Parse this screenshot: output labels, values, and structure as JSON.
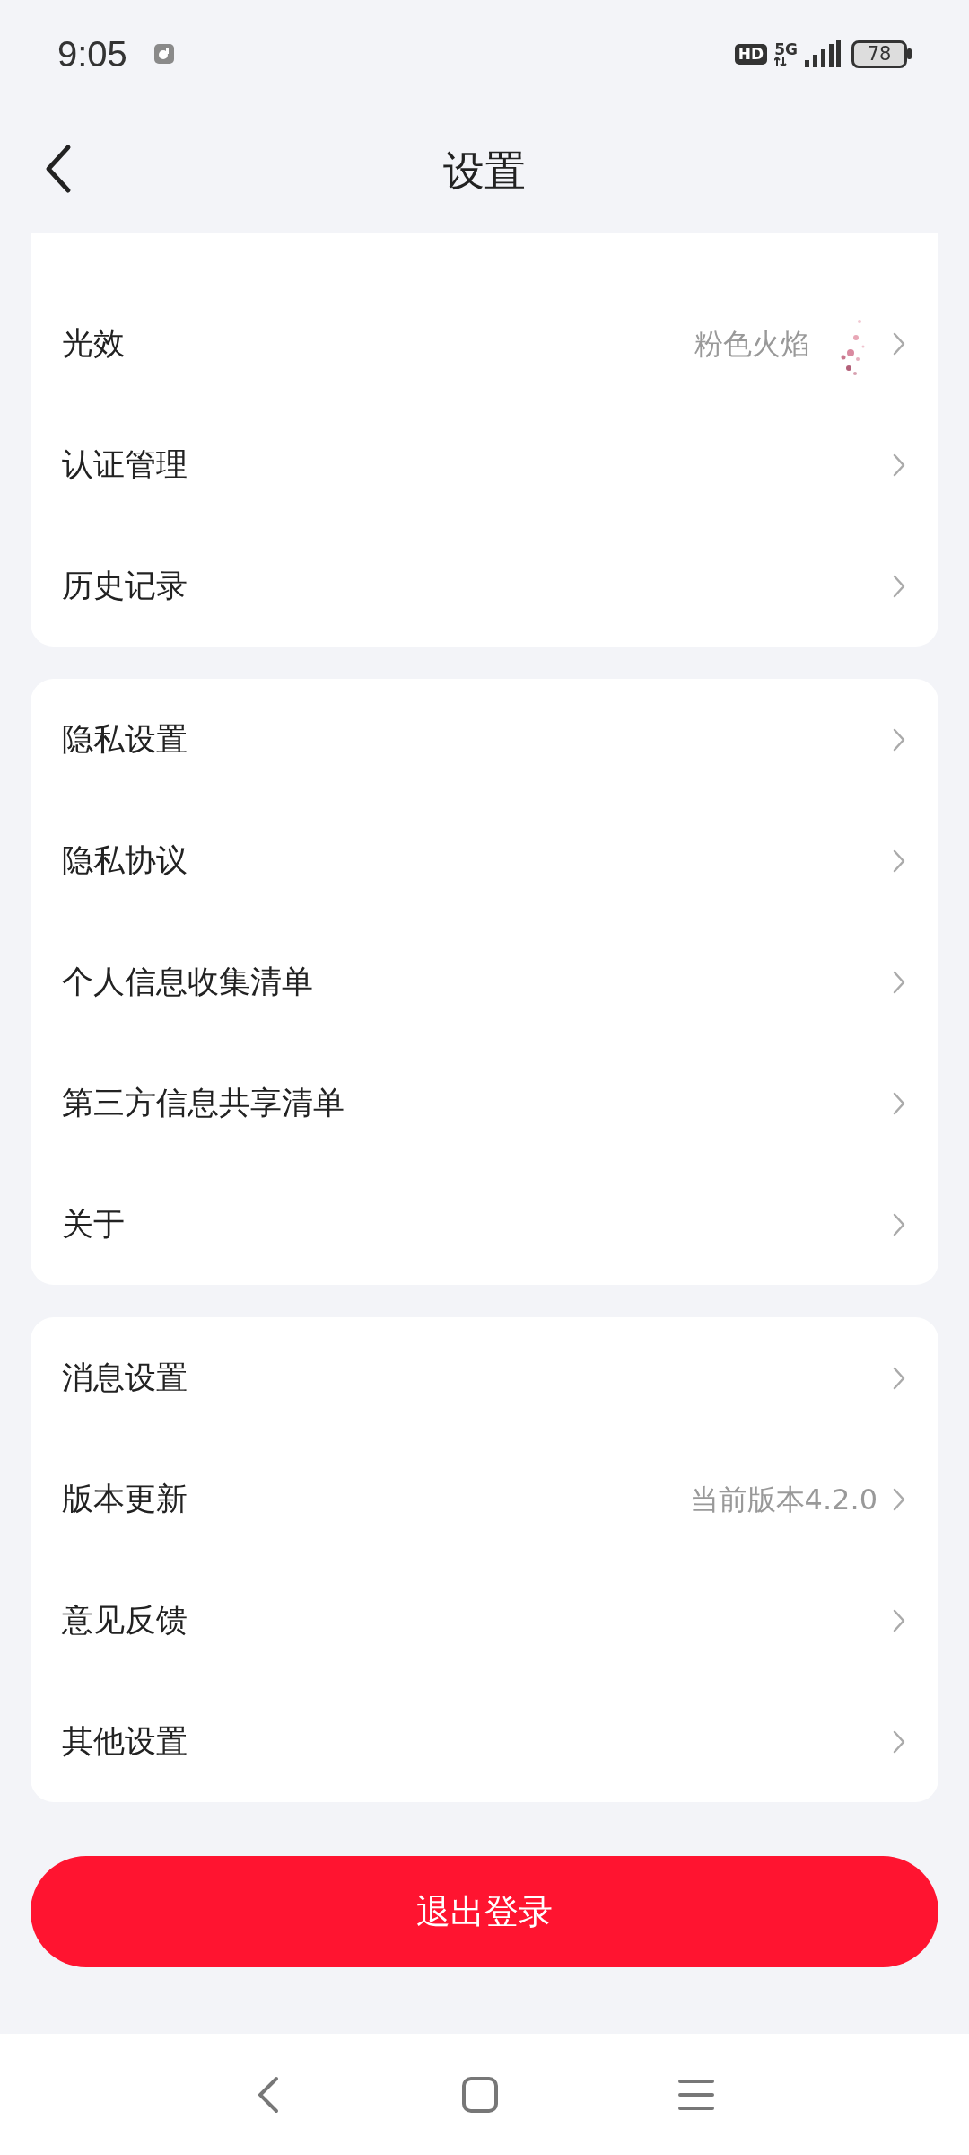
{
  "status_bar": {
    "time": "9:05",
    "hd": "HD",
    "network": "5G",
    "battery": "78"
  },
  "header": {
    "title": "设置"
  },
  "groups": [
    {
      "cut_top": true,
      "rows": [
        {
          "label": "光效",
          "value": "粉色火焰"
        },
        {
          "label": "认证管理"
        },
        {
          "label": "历史记录"
        }
      ]
    },
    {
      "cut_top": false,
      "rows": [
        {
          "label": "隐私设置"
        },
        {
          "label": "隐私协议"
        },
        {
          "label": "个人信息收集清单"
        },
        {
          "label": "第三方信息共享清单"
        },
        {
          "label": "关于"
        }
      ]
    },
    {
      "cut_top": false,
      "rows": [
        {
          "label": "消息设置"
        },
        {
          "label": "版本更新",
          "value": "当前版本4.2.0"
        },
        {
          "label": "意见反馈"
        },
        {
          "label": "其他设置"
        }
      ]
    }
  ],
  "logout_button": {
    "label": "退出登录"
  }
}
